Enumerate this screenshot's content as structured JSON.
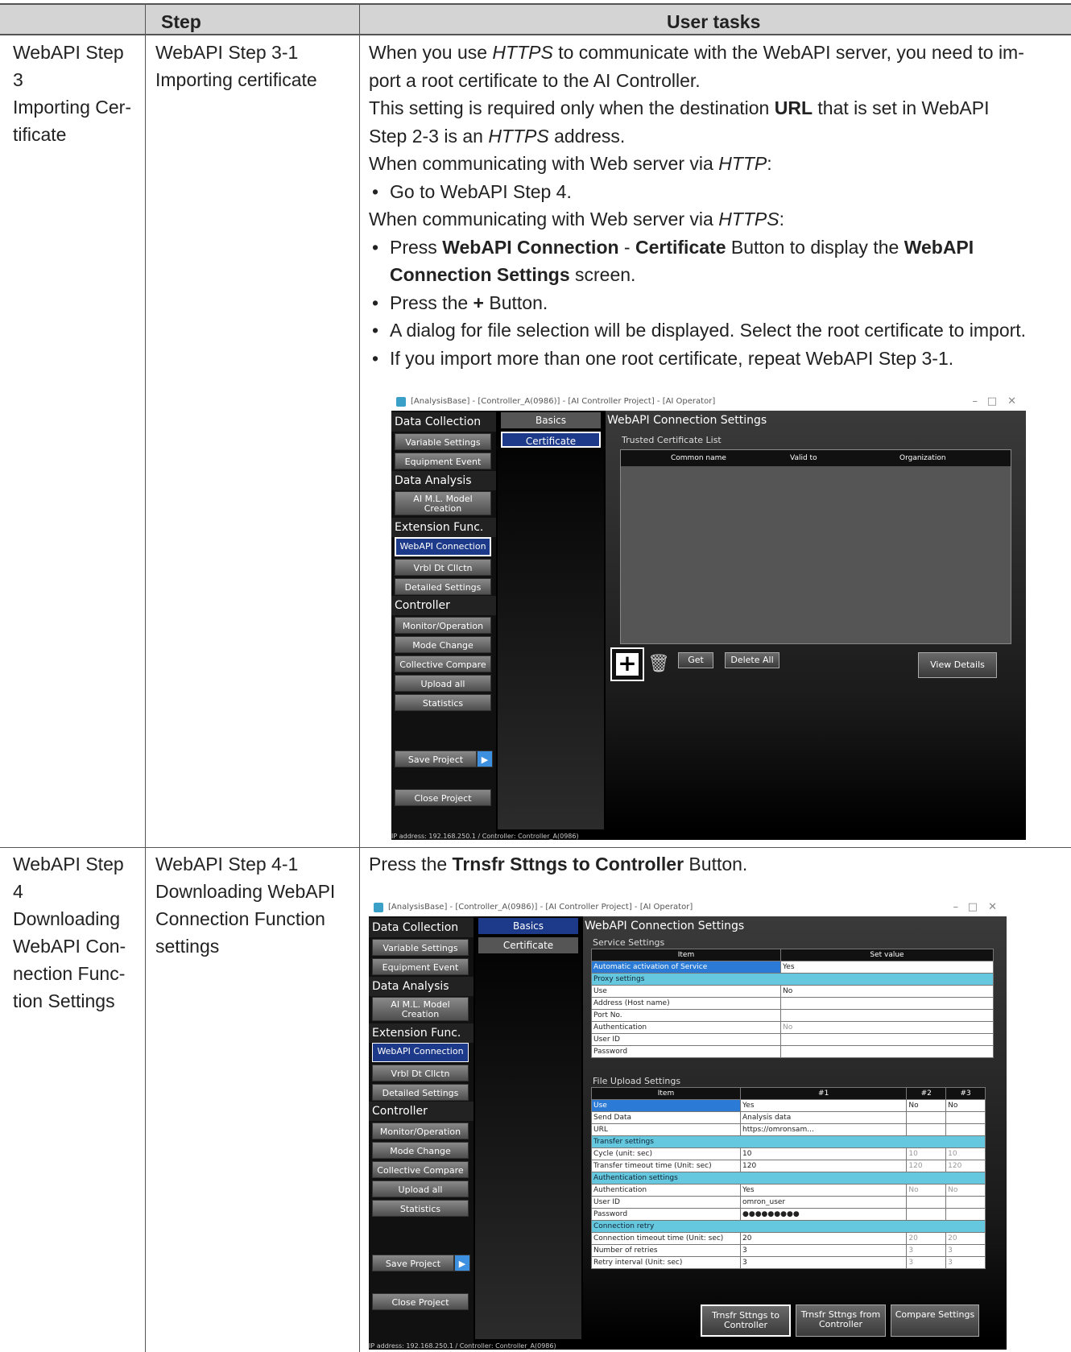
{
  "table": {
    "header_step": "Step",
    "header_tasks": "User tasks"
  },
  "row1": {
    "step_title": [
      "WebAPI Step",
      "3",
      "Importing Cer-",
      "tificate"
    ],
    "substep": [
      "WebAPI Step 3-1",
      "Importing certificate"
    ],
    "p1a": "When you use ",
    "p1b": "HTTPS",
    "p1c": " to communicate with the WebAPI server, you need to im-",
    "p2": "port a root certificate to the AI Controller.",
    "p3a": "This setting is required only when the destination ",
    "p3b": "URL",
    "p3c": " that is set in WebAPI",
    "p4a": "Step 2-3 is an ",
    "p4b": "HTTPS",
    "p4c": " address.",
    "p5a": "When communicating with Web server via ",
    "p5b": "HTTP",
    "p5c": ":",
    "b1": "Go to WebAPI Step 4.",
    "p6a": "When communicating with Web server via ",
    "p6b": "HTTPS",
    "p6c": ":",
    "b2a": "Press ",
    "b2b": "WebAPI Connection",
    "b2c": " - ",
    "b2d": "Certificate",
    "b2e": " Button to display the ",
    "b2f": "WebAPI",
    "b2g": "Connection Settings",
    "b2h": " screen.",
    "b3a": "Press the ",
    "b3b": "+",
    "b3c": " Button.",
    "b4": "A dialog for file selection will be displayed. Select the root certificate to import.",
    "b5": "If you import more than one root certificate, repeat WebAPI Step 3-1."
  },
  "row2": {
    "step_title": [
      "WebAPI Step",
      "4",
      "Downloading",
      "WebAPI Con-",
      "nection Func-",
      "tion Settings"
    ],
    "substep": [
      "WebAPI Step 4-1",
      "Downloading WebAPI",
      "Connection Function",
      "settings"
    ],
    "p1a": "Press the ",
    "p1b": "Trnsfr Sttngs to Controller",
    "p1c": " Button."
  },
  "app": {
    "title": "[AnalysisBase] - [Controller_A(0986)] - [AI Controller Project] - [AI Operator]",
    "sections": {
      "data_collection": "Data Collection",
      "data_analysis": "Data Analysis",
      "extension": "Extension Func.",
      "controller": "Controller"
    },
    "buttons": {
      "variable": "Variable Settings",
      "equipment": "Equipment Event",
      "ai_model": "AI M.L. Model Creation",
      "webapi": "WebAPI Connection",
      "vrbl": "Vrbl Dt Cllctn",
      "detailed": "Detailed Settings",
      "monitor": "Monitor/Operation",
      "mode": "Mode Change",
      "collective": "Collective Compare",
      "upload": "Upload all",
      "statistics": "Statistics",
      "save": "Save Project",
      "close": "Close Project"
    },
    "tabs": {
      "basics": "Basics",
      "certificate": "Certificate"
    },
    "screen_title": "WebAPI Connection Settings",
    "status": "IP address: 192.168.250.1 / Controller: Controller_A(0986)"
  },
  "shot1": {
    "list_title": "Trusted Certificate List",
    "columns": [
      "Common name",
      "Valid to",
      "Organization"
    ],
    "get": "Get",
    "delete_all": "Delete All",
    "view_details": "View Details"
  },
  "shot2": {
    "service_title": "Service Settings",
    "svc_cols": [
      "Item",
      "Set value"
    ],
    "svc_rows": [
      {
        "k": "Automatic activation of Service",
        "v": "Yes"
      },
      {
        "k": "Proxy settings",
        "v": ""
      },
      {
        "k": "Use",
        "v": "No"
      },
      {
        "k": "Address (Host name)",
        "v": ""
      },
      {
        "k": "Port No.",
        "v": ""
      },
      {
        "k": "Authentication",
        "v": "No"
      },
      {
        "k": "User ID",
        "v": ""
      },
      {
        "k": "Password",
        "v": ""
      }
    ],
    "file_title": "File Upload Settings",
    "file_cols": [
      "Item",
      "#1",
      "#2",
      "#3"
    ],
    "file_rows": [
      [
        "Use",
        "Yes",
        "No",
        "No"
      ],
      [
        "Send Data",
        "Analysis data",
        "",
        ""
      ],
      [
        "URL",
        "https://omronsam...",
        "",
        ""
      ],
      [
        "Transfer settings",
        "",
        "",
        ""
      ],
      [
        "Cycle (unit: sec)",
        "10",
        "10",
        "10"
      ],
      [
        "Transfer timeout time (Unit: sec)",
        "120",
        "120",
        "120"
      ],
      [
        "Authentication settings",
        "",
        "",
        ""
      ],
      [
        "Authentication",
        "Yes",
        "No",
        "No"
      ],
      [
        "User ID",
        "omron_user",
        "",
        ""
      ],
      [
        "Password",
        "●●●●●●●●●",
        "",
        ""
      ],
      [
        "Connection retry",
        "",
        "",
        ""
      ],
      [
        "Connection timeout time (Unit: sec)",
        "20",
        "20",
        "20"
      ],
      [
        "Number of retries",
        "3",
        "3",
        "3"
      ],
      [
        "Retry interval (Unit: sec)",
        "3",
        "3",
        "3"
      ]
    ],
    "btn_to": "Trnsfr Sttngs to Controller",
    "btn_from": "Trnsfr Sttngs from Controller",
    "btn_compare": "Compare Settings"
  }
}
